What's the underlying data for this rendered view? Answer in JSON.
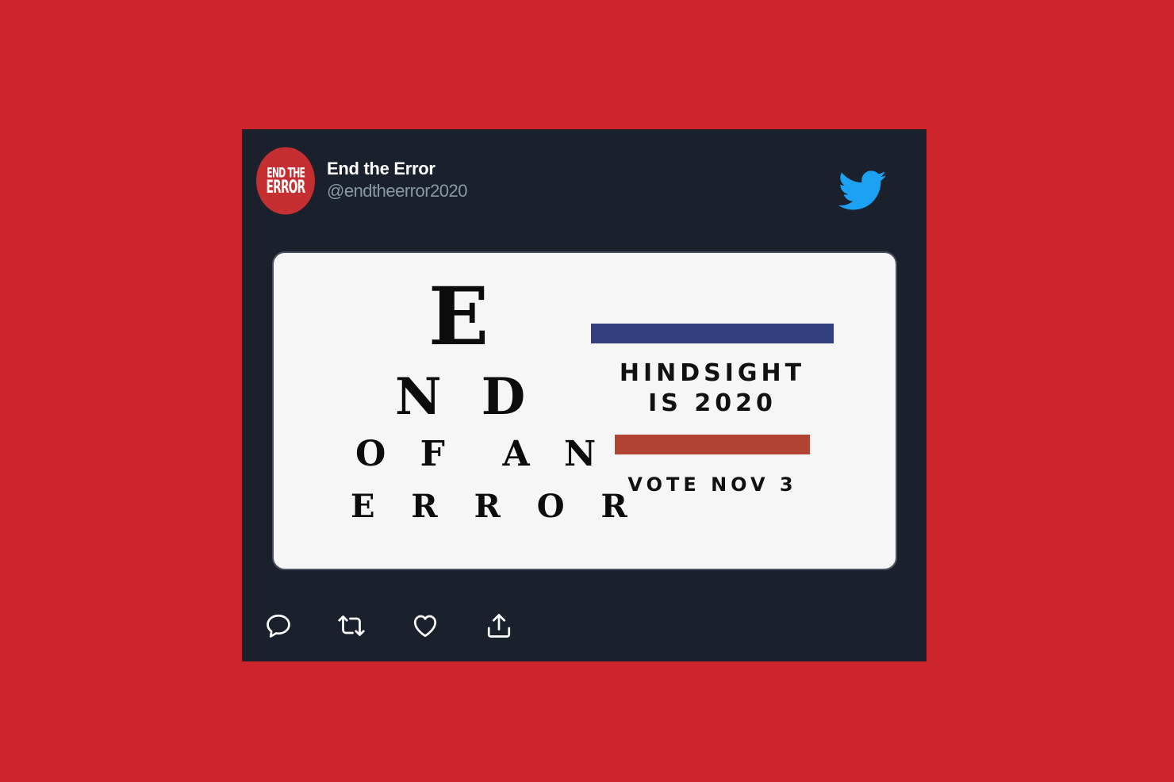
{
  "tweet": {
    "author": {
      "display_name": "End the Error",
      "handle": "@endtheerror2020",
      "avatar_text_line1": "END THE",
      "avatar_text_line2": "ERROR"
    },
    "media": {
      "eye_chart_lines": [
        "E",
        "N D",
        "O F  A N",
        "E R R O R"
      ],
      "headline_line1": "HINDSIGHT",
      "headline_line2": "IS 2020",
      "tagline": "VOTE NOV 3",
      "colors": {
        "blue_bar": "#32407e",
        "red_bar": "#b24434"
      }
    },
    "actions": [
      {
        "name": "reply",
        "icon": "reply-icon"
      },
      {
        "name": "retweet",
        "icon": "retweet-icon"
      },
      {
        "name": "like",
        "icon": "heart-icon"
      },
      {
        "name": "share",
        "icon": "share-icon"
      }
    ]
  },
  "colors": {
    "page_background": "#cd252b",
    "card_background": "#1a202c",
    "twitter_blue": "#1da1f2",
    "handle_gray": "#8899a6"
  }
}
